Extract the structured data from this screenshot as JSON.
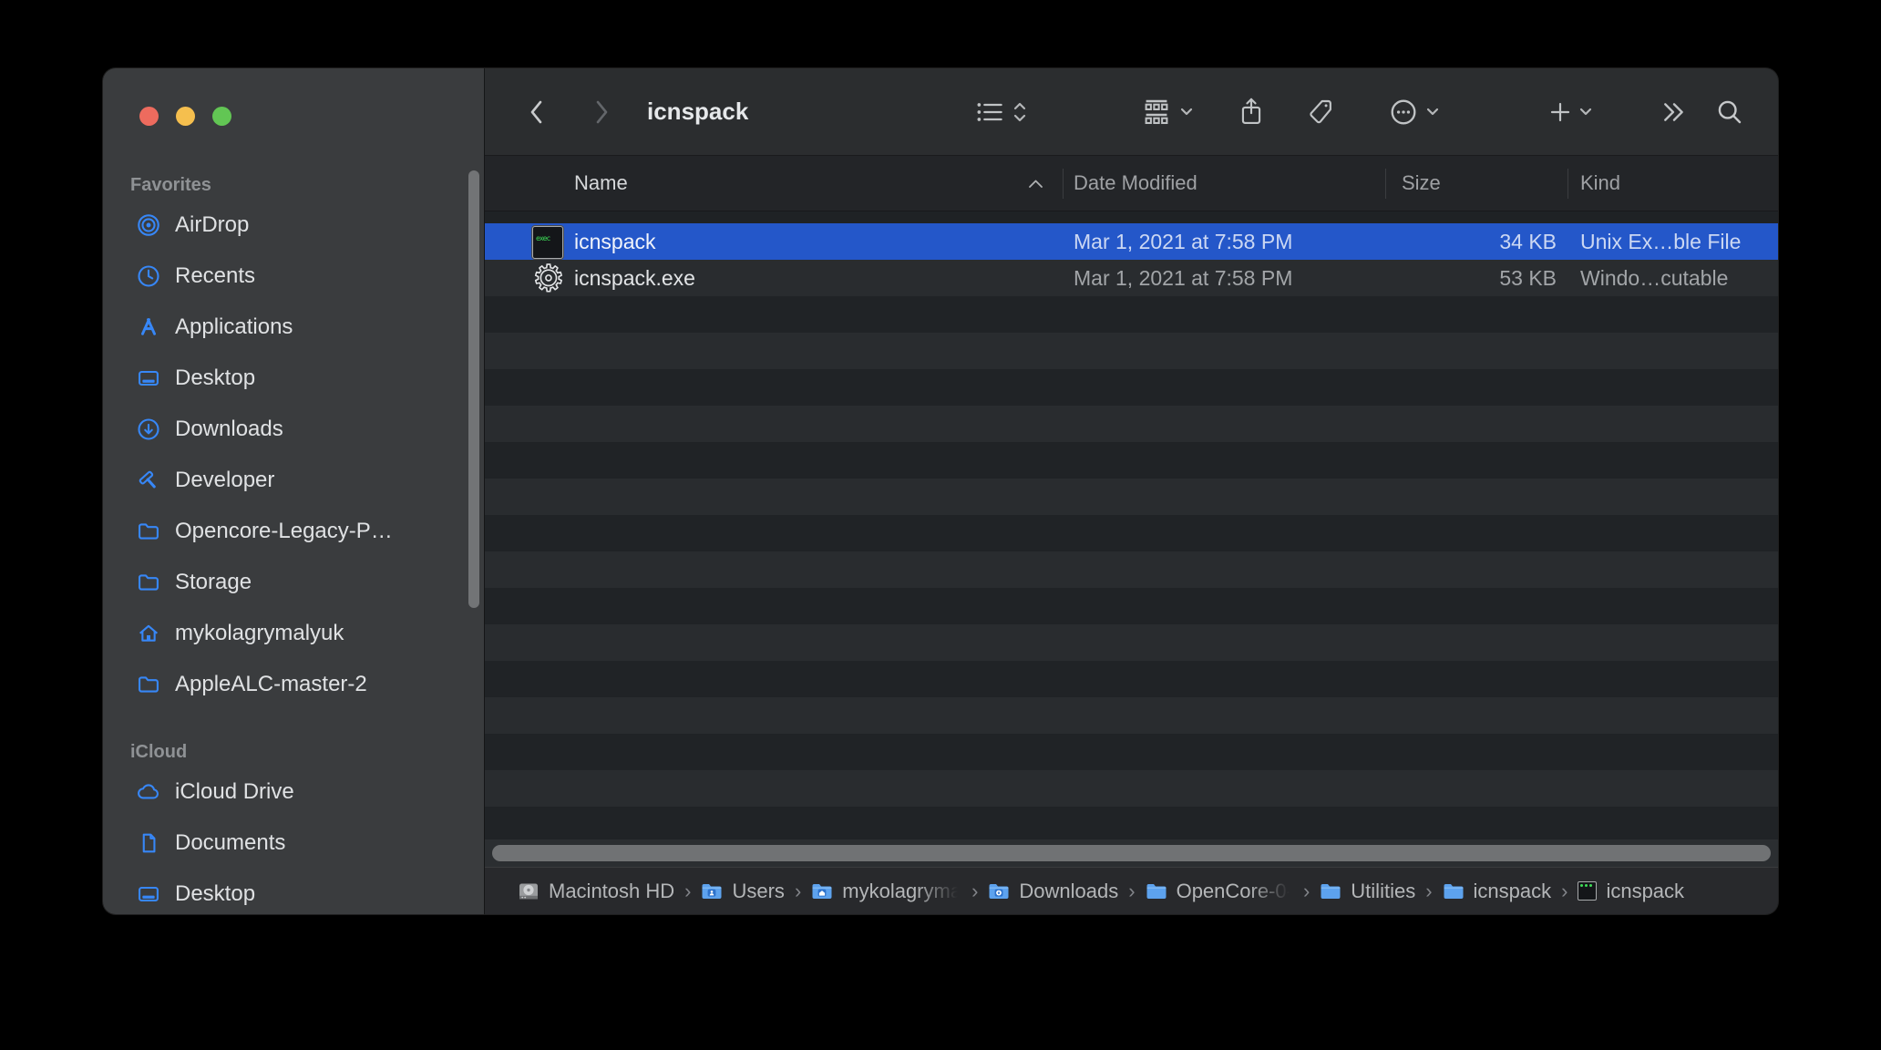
{
  "window": {
    "title": "icnspack"
  },
  "sidebar": {
    "sections": [
      {
        "title": "Favorites",
        "items": [
          {
            "label": "AirDrop"
          },
          {
            "label": "Recents"
          },
          {
            "label": "Applications"
          },
          {
            "label": "Desktop"
          },
          {
            "label": "Downloads"
          },
          {
            "label": "Developer"
          },
          {
            "label": "Opencore-Legacy-P…"
          },
          {
            "label": "Storage"
          },
          {
            "label": "mykolagrymalyuk"
          },
          {
            "label": "AppleALC-master-2"
          }
        ]
      },
      {
        "title": "iCloud",
        "items": [
          {
            "label": "iCloud Drive"
          },
          {
            "label": "Documents"
          },
          {
            "label": "Desktop"
          }
        ]
      }
    ]
  },
  "columns": {
    "name": "Name",
    "date_modified": "Date Modified",
    "size": "Size",
    "kind": "Kind"
  },
  "files": [
    {
      "name": "icnspack",
      "date_modified": "Mar 1, 2021 at 7:58 PM",
      "size": "34 KB",
      "kind": "Unix Ex…ble File",
      "icon": "unix-executable",
      "icon_text": "exec",
      "selected": true
    },
    {
      "name": "icnspack.exe",
      "date_modified": "Mar 1, 2021 at 7:58 PM",
      "size": "53 KB",
      "kind": "Windo…cutable",
      "icon": "windows-executable",
      "gear_glyph": "⚙",
      "selected": false
    }
  ],
  "path_bar": {
    "separator": "›",
    "items": [
      {
        "icon": "hard-drive",
        "label": "Macintosh HD"
      },
      {
        "icon": "folder-users",
        "label": "Users"
      },
      {
        "icon": "folder-home",
        "label": "mykolagryma"
      },
      {
        "icon": "folder-downloads",
        "label": "Downloads"
      },
      {
        "icon": "folder",
        "label": "OpenCore-0-"
      },
      {
        "icon": "folder",
        "label": "Utilities"
      },
      {
        "icon": "folder",
        "label": "icnspack"
      },
      {
        "icon": "unix-executable",
        "label": "icnspack"
      }
    ]
  },
  "colors": {
    "selection_blue": "#2457c9",
    "sidebar_icon_blue": "#3787f7",
    "traffic_red": "#ed6b5e",
    "traffic_yellow": "#f5bf4e",
    "traffic_green": "#62c654",
    "sidebar_bg": "#3a3c3e",
    "toolbar_bg": "#2b2d2f",
    "row_stripe_dark": "#202326",
    "row_stripe_light": "#292c2f"
  }
}
